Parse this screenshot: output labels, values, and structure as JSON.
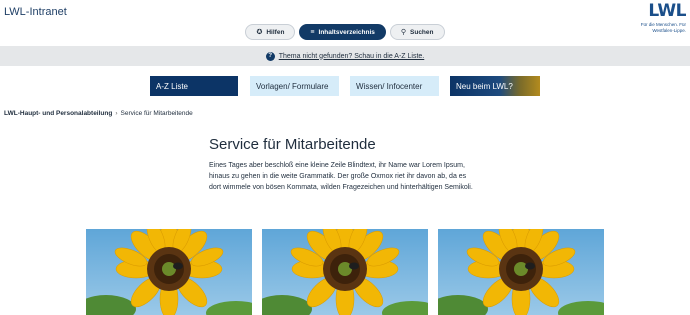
{
  "header": {
    "site_title": "LWL-Intranet",
    "logo_mark": "LWL",
    "logo_tagline": "Für die Menschen. Für Westfalen-Lippe."
  },
  "top_buttons": [
    {
      "label": "Hilfen",
      "icon": "info-icon"
    },
    {
      "label": "Inhaltsverzeichnis",
      "icon": "list-icon"
    },
    {
      "label": "Suchen",
      "icon": "search-icon"
    }
  ],
  "notice": {
    "text": "Thema nicht gefunden? Schau in die A-Z Liste."
  },
  "tabs": [
    {
      "label": "A-Z Liste"
    },
    {
      "label": "Vorlagen/ Formulare"
    },
    {
      "label": "Wissen/ Infocenter"
    },
    {
      "label": "Neu beim LWL?"
    }
  ],
  "breadcrumb": {
    "link": "LWL-Haupt- und Personalabteilung",
    "separator": "›",
    "current": "Service für Mitarbeitende"
  },
  "main": {
    "title": "Service für Mitarbeitende",
    "intro": "Eines Tages aber beschloß eine kleine Zeile Blindtext, ihr Name war Lorem Ipsum, hinaus zu gehen in die weite Grammatik. Der große Oxmox riet ihr davon ab, da es dort wimmele von bösen Kommata, wilden Fragezeichen und hinterhältigen Semikoli."
  },
  "colors": {
    "brand": "#123a66",
    "tab_light": "#d6ecf9",
    "notice_bg": "#e5e7e9"
  }
}
